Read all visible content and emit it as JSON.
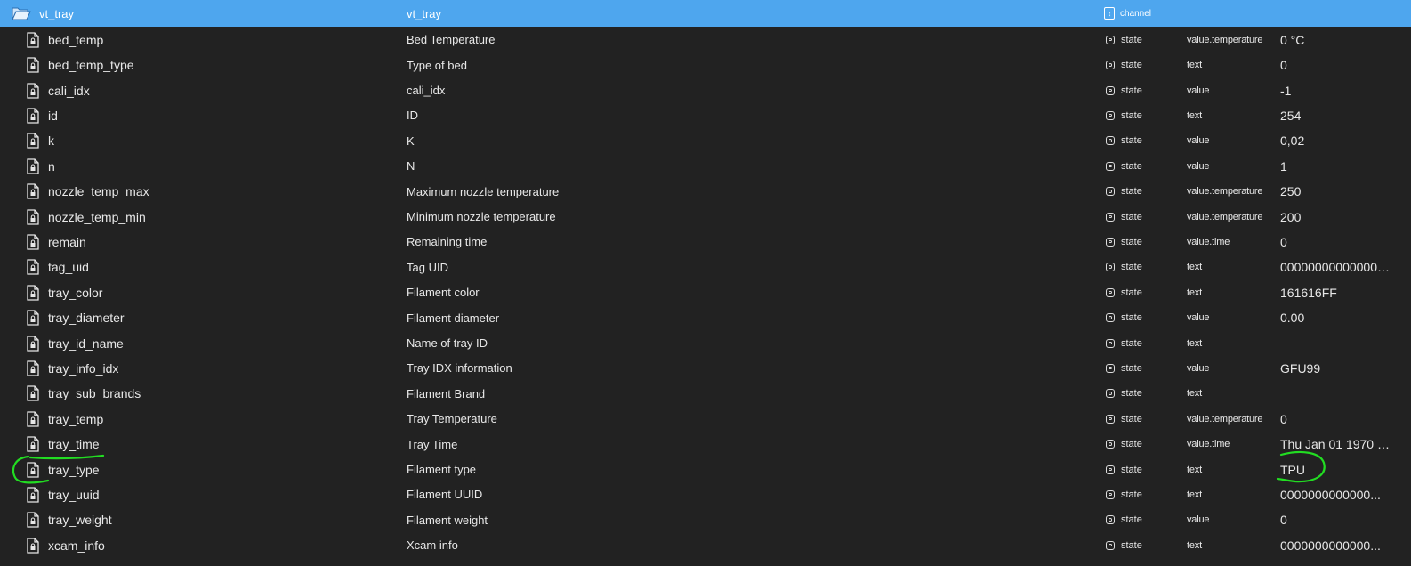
{
  "header": {
    "id": "vt_tray",
    "name": "vt_tray",
    "type": "channel",
    "icon": "folder-open-icon",
    "type_icon": "channel-icon"
  },
  "rows": [
    {
      "id": "bed_temp",
      "name": "Bed Temperature",
      "type": "state",
      "role": "value.temperature",
      "value": "0 °C"
    },
    {
      "id": "bed_temp_type",
      "name": "Type of bed",
      "type": "state",
      "role": "text",
      "value": "0"
    },
    {
      "id": "cali_idx",
      "name": "cali_idx",
      "type": "state",
      "role": "value",
      "value": "-1"
    },
    {
      "id": "id",
      "name": "ID",
      "type": "state",
      "role": "text",
      "value": "254"
    },
    {
      "id": "k",
      "name": "K",
      "type": "state",
      "role": "value",
      "value": "0,02"
    },
    {
      "id": "n",
      "name": "N",
      "type": "state",
      "role": "value",
      "value": "1"
    },
    {
      "id": "nozzle_temp_max",
      "name": "Maximum nozzle temperature",
      "type": "state",
      "role": "value.temperature",
      "value": "250"
    },
    {
      "id": "nozzle_temp_min",
      "name": "Minimum nozzle temperature",
      "type": "state",
      "role": "value.temperature",
      "value": "200"
    },
    {
      "id": "remain",
      "name": "Remaining time",
      "type": "state",
      "role": "value.time",
      "value": "0"
    },
    {
      "id": "tag_uid",
      "name": "Tag UID",
      "type": "state",
      "role": "text",
      "value": "0000000000000000"
    },
    {
      "id": "tray_color",
      "name": "Filament color",
      "type": "state",
      "role": "text",
      "value": "161616FF"
    },
    {
      "id": "tray_diameter",
      "name": "Filament diameter",
      "type": "state",
      "role": "value",
      "value": "0.00"
    },
    {
      "id": "tray_id_name",
      "name": "Name of tray ID",
      "type": "state",
      "role": "text",
      "value": ""
    },
    {
      "id": "tray_info_idx",
      "name": "Tray IDX information",
      "type": "state",
      "role": "value",
      "value": "GFU99"
    },
    {
      "id": "tray_sub_brands",
      "name": "Filament Brand",
      "type": "state",
      "role": "text",
      "value": ""
    },
    {
      "id": "tray_temp",
      "name": "Tray Temperature",
      "type": "state",
      "role": "value.temperature",
      "value": "0"
    },
    {
      "id": "tray_time",
      "name": "Tray Time",
      "type": "state",
      "role": "value.time",
      "value": "Thu Jan 01 1970 0..."
    },
    {
      "id": "tray_type",
      "name": "Filament type",
      "type": "state",
      "role": "text",
      "value": "TPU"
    },
    {
      "id": "tray_uuid",
      "name": "Filament UUID",
      "type": "state",
      "role": "text",
      "value": "0000000000000..."
    },
    {
      "id": "tray_weight",
      "name": "Filament weight",
      "type": "state",
      "role": "value",
      "value": "0"
    },
    {
      "id": "xcam_info",
      "name": "Xcam info",
      "type": "state",
      "role": "text",
      "value": "0000000000000..."
    }
  ],
  "row_icon": "file-lock-icon",
  "state_icon": "state-icon",
  "colors": {
    "background": "#222222",
    "header_bg": "#4ea6ee",
    "text": "#e8e8e8",
    "annotation": "#22dd22"
  }
}
